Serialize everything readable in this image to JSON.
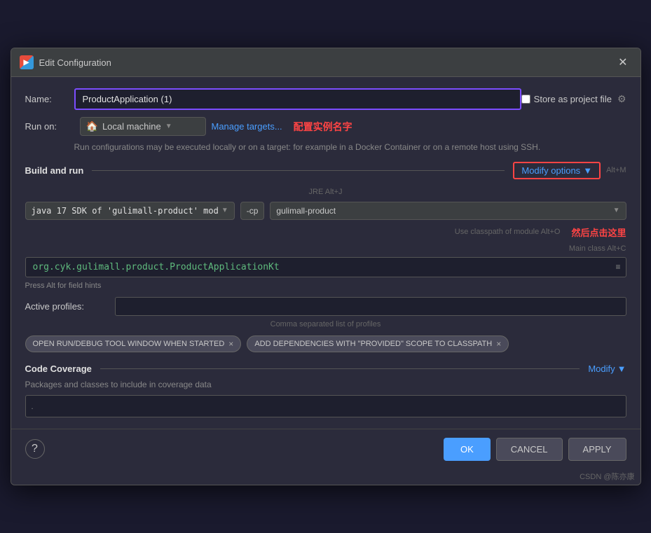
{
  "dialog": {
    "title": "Edit Configuration",
    "close_label": "✕"
  },
  "title_icon": "▶",
  "name_label": "Name:",
  "name_value": "ProductApplication (1)",
  "store_as_project_label": "Store as project file",
  "run_on_label": "Run on:",
  "run_on_value": "Local machine",
  "manage_targets_link": "Manage targets...",
  "annotation_config_name": "配置实例名字",
  "hint_text": "Run configurations may be executed locally or on a target: for example in a Docker Container or on a remote host using SSH.",
  "build_and_run_title": "Build and run",
  "modify_options_label": "Modify options",
  "modify_options_shortcut": "Alt+M",
  "jre_hint": "JRE Alt+J",
  "sdk_value": "java 17  SDK of 'gulimall-product' mod",
  "cp_flag": "-cp",
  "cp_value": "gulimall-product",
  "use_classpath_hint": "Use classpath of module Alt+O",
  "then_click_here": "然后点击这里",
  "main_class_hint": "Main class Alt+C",
  "main_class_value": "org.cyk.gulimall.product.ProductApplicationKt",
  "alt_hint": "Press Alt for field hints",
  "active_profiles_label": "Active profiles:",
  "profiles_hint": "Comma separated list of profiles",
  "tag1_label": "OPEN RUN/DEBUG TOOL WINDOW WHEN STARTED",
  "tag1_close": "×",
  "tag2_label": "ADD DEPENDENCIES WITH \"PROVIDED\" SCOPE TO CLASSPATH",
  "tag2_close": "×",
  "code_coverage_title": "Code Coverage",
  "modify_coverage_label": "Modify",
  "coverage_hint": "Packages and classes to include in coverage data",
  "footer": {
    "help_label": "?",
    "ok_label": "OK",
    "cancel_label": "CANCEL",
    "apply_label": "APPLY"
  },
  "watermark": "CSDN @陈亦康"
}
